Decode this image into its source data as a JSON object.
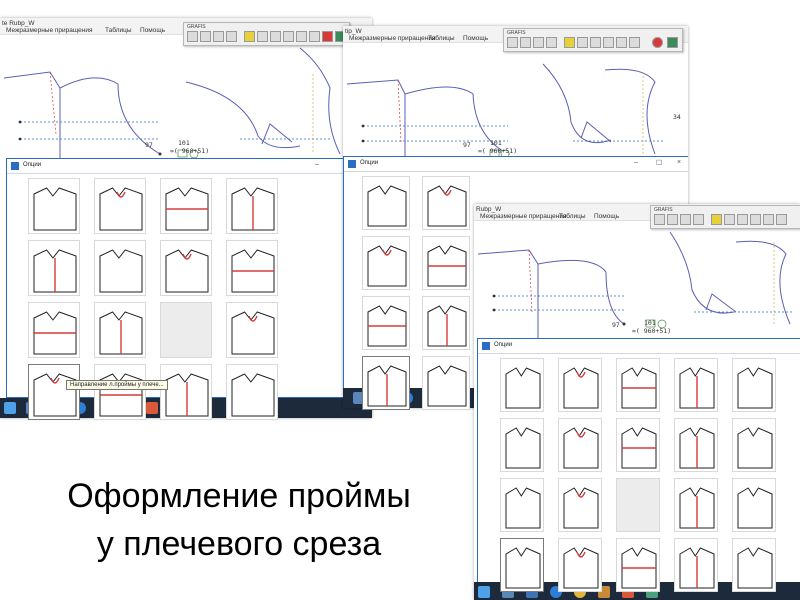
{
  "screens": [
    {
      "title_fragment": "te Rubp_W",
      "menu": [
        "Межразмерные приращения",
        "Таблицы",
        "Помощь"
      ],
      "toolbar_title": "GRAFIS",
      "measure_a": "97",
      "measure_b": "101",
      "measure_c": "=( 960+51)",
      "options_title": "Опции",
      "tooltip": "Направление л.проймы у плече..."
    },
    {
      "title_fragment": "tip_W",
      "menu": [
        "Межразмерные приращения",
        "Таблицы",
        "Помощь"
      ],
      "toolbar_title": "GRAFIS",
      "measure_a": "97",
      "measure_b": "101",
      "measure_c": "=( 960+51)",
      "side_value": "34",
      "options_title": "Опции"
    },
    {
      "title_fragment": "Rubp_W",
      "menu": [
        "Межразмерные приращения",
        "Таблицы",
        "Помощь"
      ],
      "toolbar_title": "GRAFIS",
      "measure_a": "97",
      "measure_b": "101",
      "measure_c": "=( 960+51)",
      "options_title": "Опции"
    }
  ],
  "heading": {
    "line1": "Оформление проймы",
    "line2": "у плечевого среза"
  },
  "icons": {
    "taskbar": [
      "windows-start-icon",
      "file-icon",
      "photos-icon",
      "edge-icon",
      "chrome-icon",
      "tools-icon",
      "pdf-icon",
      "grafis-icon"
    ],
    "toolbar": [
      "new-icon",
      "save-icon",
      "zoom-icon",
      "print-icon",
      "ruler-icon",
      "grid-icon",
      "cut-icon",
      "rotate-icon",
      "arrow-down-icon",
      "weight-icon",
      "stop-icon",
      "exit-icon"
    ]
  },
  "colors": {
    "pattern_line": "#5a5fb4",
    "highlight": "#d83a3a",
    "taskbar": "#1d2a3c"
  }
}
